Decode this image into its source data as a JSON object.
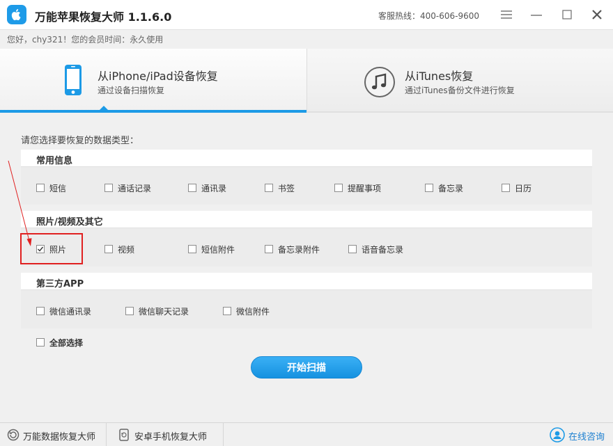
{
  "app": {
    "title": "万能苹果恢复大师 1.1.6.0",
    "hotline": "客服热线：400-606-9600",
    "logo_icon": "apple-logo-icon",
    "accent": "#1c9ae6"
  },
  "user": {
    "welcome": "您好，chy321！您的会员时间：永久使用"
  },
  "modes": [
    {
      "title": "从iPhone/iPad设备恢复",
      "subtitle": "通过设备扫描恢复",
      "icon": "phone-icon",
      "active": true
    },
    {
      "title": "从iTunes恢复",
      "subtitle": "通过iTunes备份文件进行恢复",
      "icon": "music-note-icon",
      "active": false
    }
  ],
  "prompt": "请您选择要恢复的数据类型：",
  "groups": [
    {
      "title": "常用信息",
      "options": [
        {
          "label": "短信",
          "checked": false
        },
        {
          "label": "通话记录",
          "checked": false
        },
        {
          "label": "通讯录",
          "checked": false
        },
        {
          "label": "书签",
          "checked": false
        },
        {
          "label": "提醒事项",
          "checked": false
        },
        {
          "label": "备忘录",
          "checked": false
        },
        {
          "label": "日历",
          "checked": false
        }
      ]
    },
    {
      "title": "照片/视频及其它",
      "options": [
        {
          "label": "照片",
          "checked": true
        },
        {
          "label": "视频",
          "checked": false
        },
        {
          "label": "短信附件",
          "checked": false
        },
        {
          "label": "备忘录附件",
          "checked": false
        },
        {
          "label": "语音备忘录",
          "checked": false
        }
      ]
    },
    {
      "title": "第三方APP",
      "options": [
        {
          "label": "微信通讯录",
          "checked": false
        },
        {
          "label": "微信聊天记录",
          "checked": false
        },
        {
          "label": "微信附件",
          "checked": false
        }
      ]
    }
  ],
  "select_all": {
    "label": "全部选择",
    "checked": false
  },
  "scan_button": "开始扫描",
  "footer": {
    "links": [
      {
        "label": "万能数据恢复大师",
        "icon": "refresh-disk-icon"
      },
      {
        "label": "安卓手机恢复大师",
        "icon": "android-phone-icon"
      }
    ],
    "support": {
      "label": "在线咨询",
      "icon": "support-agent-icon"
    }
  },
  "colors": {
    "highlight_box": "#e02020",
    "annotation_arrow": "#e02020"
  }
}
